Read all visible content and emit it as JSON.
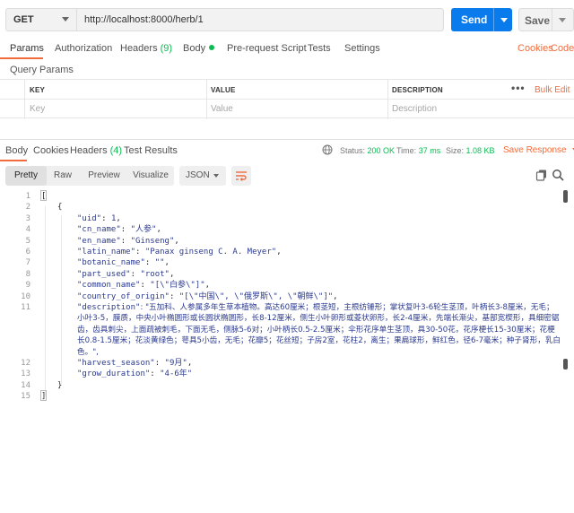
{
  "request": {
    "method": "GET",
    "url": "http://localhost:8000/herb/1",
    "send_label": "Send",
    "save_label": "Save"
  },
  "request_tabs": {
    "params": "Params",
    "authorization": "Authorization",
    "headers": "Headers",
    "headers_count": "(9)",
    "body": "Body",
    "prerequest": "Pre-request Script",
    "tests": "Tests",
    "settings": "Settings",
    "cookies": "Cookies",
    "code": "Code"
  },
  "query_params": {
    "title": "Query Params",
    "columns": [
      "KEY",
      "VALUE",
      "DESCRIPTION"
    ],
    "placeholders": [
      "Key",
      "Value",
      "Description"
    ],
    "more": "•••",
    "bulk_edit": "Bulk Edit"
  },
  "response_tabs": {
    "body": "Body",
    "cookies": "Cookies",
    "headers": "Headers",
    "headers_count": "(4)",
    "test_results": "Test Results"
  },
  "response_status": {
    "status_label": "Status:",
    "status_value": "200 OK",
    "time_label": "Time:",
    "time_value": "37 ms",
    "size_label": "Size:",
    "size_value": "1.08 KB",
    "save_response": "Save Response"
  },
  "view_modes": [
    "Pretty",
    "Raw",
    "Preview",
    "Visualize"
  ],
  "active_view": "Pretty",
  "format": "JSON",
  "code_lines": {
    "l1": "[",
    "l2": "{",
    "uid_key": "\"uid\"",
    "uid_val": "1",
    "cn_key": "\"cn_name\"",
    "cn_val": "\"人参\"",
    "en_key": "\"en_name\"",
    "en_val": "\"Ginseng\"",
    "latin_key": "\"latin_name\"",
    "latin_val": "\"Panax ginseng C. A. Meyer\"",
    "botanic_key": "\"botanic_name\"",
    "botanic_val": "\"\"",
    "part_key": "\"part_used\"",
    "part_val": "\"root\"",
    "common_key": "\"common_name\"",
    "common_val": "\"[\\\"白参\\\"]\"",
    "country_key": "\"country_of_origin\"",
    "country_val": "\"[\\\"中国\\\", \\\"俄罗斯\\\", \\\"朝鲜\\\"]\"",
    "desc_key": "\"description\"",
    "desc_val": "\"五加科、人参属多年生草本植物。高达60厘米；根茎短，主根纺锤形；掌状复叶3-6轮生茎顶，叶柄长3-8厘米，无毛；小叶3-5，膜质，中央小叶椭圆形或长圆状椭圆形，长8-12厘米，侧生小叶卵形或菱状卵形，长2-4厘米，先端长渐尖，基部宽楔形，具细密锯齿，齿具刺尖，上面疏被刺毛，下面无毛，侧脉5-6对；小叶柄长0.5-2.5厘米；伞形花序单生茎顶，具30-50花，花序梗长15-30厘米；花梗长0.8-1.5厘米；花淡黄绿色；萼具5小齿，无毛；花瓣5；花丝短；子房2室，花柱2，离生；果扁球形，鲜红色，径6-7毫米；种子肾形，乳白色。\"",
    "harvest_key": "\"harvest_season\"",
    "harvest_val": "\"9月\"",
    "grow_key": "\"grow_duration\"",
    "grow_val": "\"4-6年\"",
    "l14": "}",
    "l15": "]"
  },
  "line_numbers": [
    "1",
    "2",
    "3",
    "4",
    "5",
    "6",
    "7",
    "8",
    "9",
    "10",
    "11",
    "12",
    "13",
    "14",
    "15"
  ],
  "colors": {
    "accent": "#f26b3a",
    "send_blue": "#097bed",
    "success_green": "#0cbb52"
  }
}
